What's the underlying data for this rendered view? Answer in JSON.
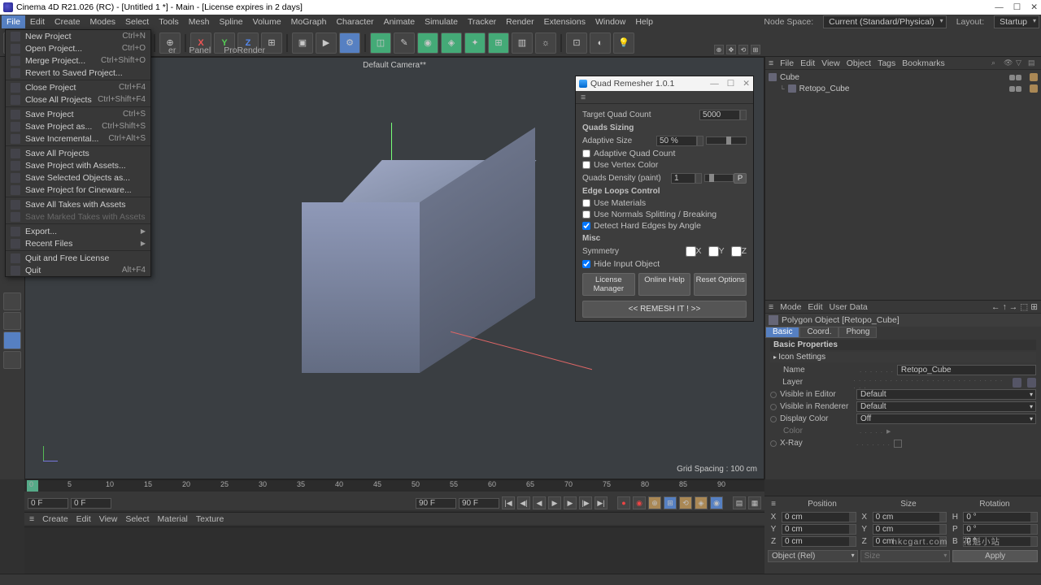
{
  "title": "Cinema 4D R21.026 (RC) - [Untitled 1 *] - Main - [License expires in 2 days]",
  "menubar": [
    "File",
    "Edit",
    "Create",
    "Modes",
    "Select",
    "Tools",
    "Mesh",
    "Spline",
    "Volume",
    "MoGraph",
    "Character",
    "Animate",
    "Simulate",
    "Tracker",
    "Render",
    "Extensions",
    "Window",
    "Help"
  ],
  "menuright": {
    "ns_lbl": "Node Space:",
    "ns_val": "Current (Standard/Physical)",
    "ly_lbl": "Layout:",
    "ly_val": "Startup"
  },
  "filemenu": [
    {
      "label": "New Project",
      "sc": "Ctrl+N"
    },
    {
      "label": "Open Project...",
      "sc": "Ctrl+O"
    },
    {
      "label": "Merge Project...",
      "sc": "Ctrl+Shift+O"
    },
    {
      "label": "Revert to Saved Project..."
    },
    {
      "sep": true
    },
    {
      "label": "Close Project",
      "sc": "Ctrl+F4"
    },
    {
      "label": "Close All Projects",
      "sc": "Ctrl+Shift+F4"
    },
    {
      "sep": true
    },
    {
      "label": "Save Project",
      "sc": "Ctrl+S"
    },
    {
      "label": "Save Project as...",
      "sc": "Ctrl+Shift+S"
    },
    {
      "label": "Save Incremental...",
      "sc": "Ctrl+Alt+S"
    },
    {
      "sep": true
    },
    {
      "label": "Save All Projects"
    },
    {
      "label": "Save Project with Assets..."
    },
    {
      "label": "Save Selected Objects as..."
    },
    {
      "label": "Save Project for Cineware..."
    },
    {
      "sep": true
    },
    {
      "label": "Save All Takes with Assets"
    },
    {
      "label": "Save Marked Takes with Assets",
      "dis": true
    },
    {
      "sep": true
    },
    {
      "label": "Export...",
      "sub": true
    },
    {
      "label": "Recent Files",
      "sub": true
    },
    {
      "sep": true
    },
    {
      "label": "Quit and Free License"
    },
    {
      "label": "Quit",
      "sc": "Alt+F4"
    }
  ],
  "viewport": {
    "tabs": [
      "er",
      "Panel",
      "ProRender"
    ],
    "cam": "Default Camera**",
    "grid": "Grid Spacing : 100 cm"
  },
  "qr": {
    "title": "Quad Remesher 1.0.1",
    "target_lbl": "Target Quad Count",
    "target_val": "5000",
    "sizing": "Quads Sizing",
    "adapt_lbl": "Adaptive Size",
    "adapt_val": "50 %",
    "aqc": "Adaptive Quad Count",
    "uvc": "Use Vertex Color",
    "density_lbl": "Quads Density (paint)",
    "density_val": "1",
    "density_p": "P",
    "edge": "Edge Loops Control",
    "umat": "Use Materials",
    "unorm": "Use Normals Splitting / Breaking",
    "dhard": "Detect Hard Edges by Angle",
    "misc": "Misc",
    "sym": "Symmetry",
    "x": "X",
    "y": "Y",
    "z": "Z",
    "hide": "Hide Input Object",
    "lic": "License Manager",
    "help": "Online Help",
    "reset": "Reset Options",
    "remesh": "<<   REMESH IT !   >>"
  },
  "objmgr": {
    "menus": [
      "File",
      "Edit",
      "View",
      "Object",
      "Tags",
      "Bookmarks"
    ],
    "items": [
      {
        "name": "Cube"
      },
      {
        "name": "Retopo_Cube"
      }
    ]
  },
  "attr": {
    "menus": [
      "Mode",
      "Edit",
      "User Data"
    ],
    "objtype": "Polygon Object [Retopo_Cube]",
    "tabs": [
      "Basic",
      "Coord.",
      "Phong"
    ],
    "section": "Basic Properties",
    "iconset": "Icon Settings",
    "name_lbl": "Name",
    "name_val": "Retopo_Cube",
    "layer_lbl": "Layer",
    "vise_lbl": "Visible in Editor",
    "vise_val": "Default",
    "visr_lbl": "Visible in Renderer",
    "visr_val": "Default",
    "disp_lbl": "Display Color",
    "disp_val": "Off",
    "color_lbl": "Color",
    "xray_lbl": "X-Ray"
  },
  "timeline": {
    "ticks": [
      "0",
      "5",
      "10",
      "15",
      "20",
      "25",
      "30",
      "35",
      "40",
      "45",
      "50",
      "55",
      "60",
      "65",
      "70",
      "75",
      "80",
      "85",
      "90"
    ],
    "start": "0 F",
    "cur": "0 F",
    "end1": "90 F",
    "end2": "90 F"
  },
  "matbar": [
    "Create",
    "Edit",
    "View",
    "Select",
    "Material",
    "Texture"
  ],
  "coord": {
    "headers": [
      "Position",
      "Size",
      "Rotation"
    ],
    "rows": [
      {
        "a": "X",
        "p": "0 cm",
        "s": "0 cm",
        "r": "0 °",
        "sa": "X",
        "ra": "H"
      },
      {
        "a": "Y",
        "p": "0 cm",
        "s": "0 cm",
        "r": "0 °",
        "sa": "Y",
        "ra": "P"
      },
      {
        "a": "Z",
        "p": "0 cm",
        "s": "0 cm",
        "r": "0 °",
        "sa": "Z",
        "ra": "B"
      }
    ],
    "objdrop": "Object (Rel)",
    "sizedrop": "Size",
    "apply": "Apply"
  },
  "watermark": {
    "en": "hkcgart.com",
    "cn": "花魁小站"
  }
}
